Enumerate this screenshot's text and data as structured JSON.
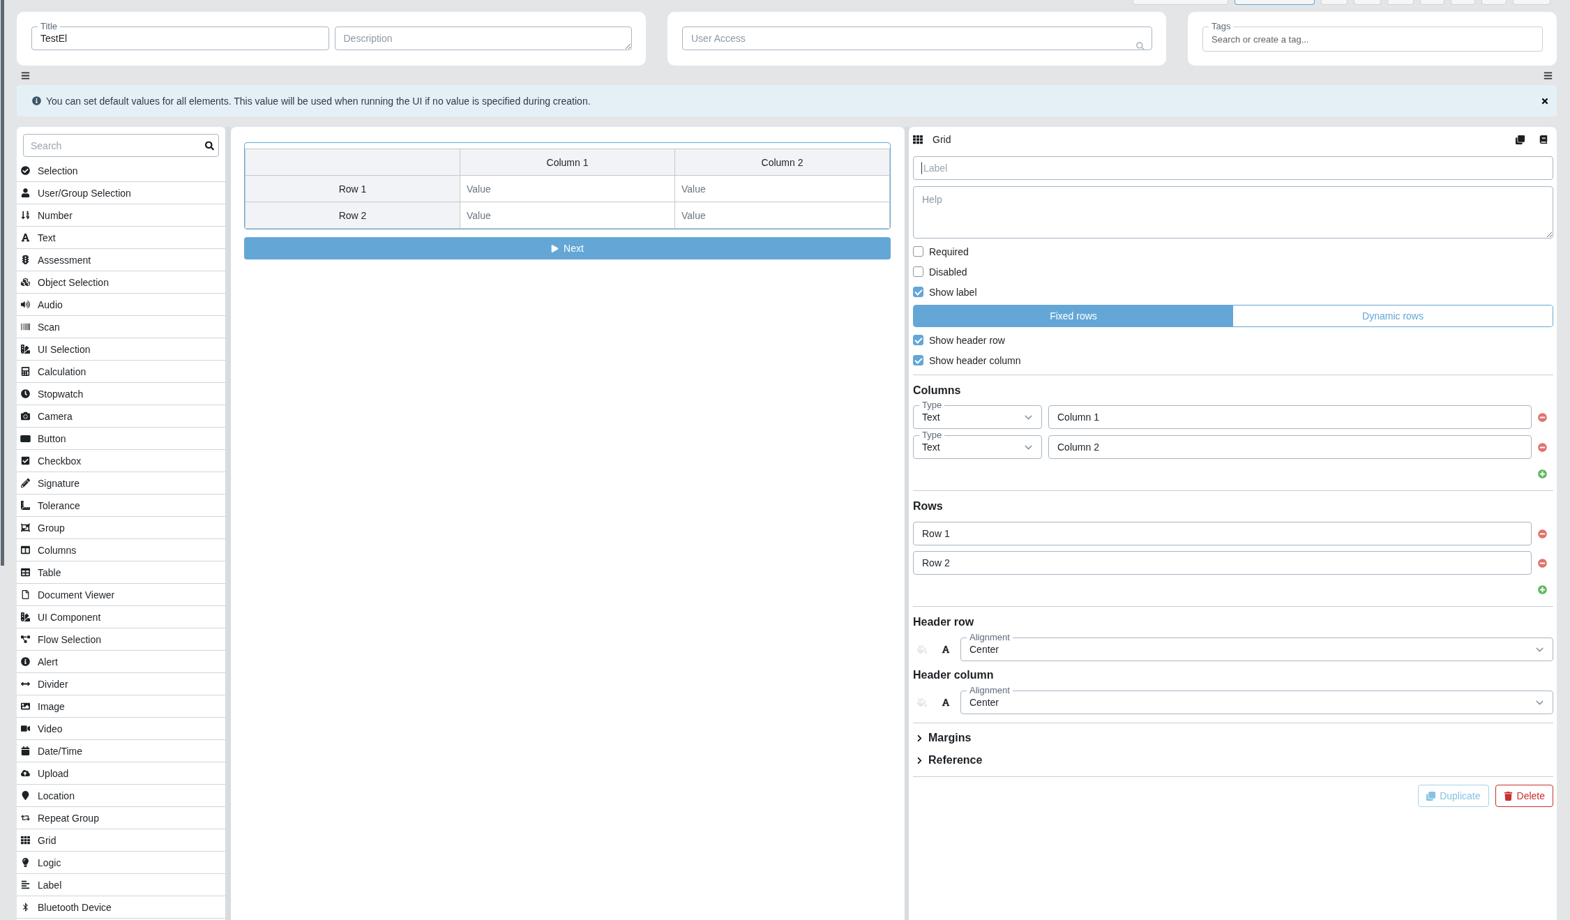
{
  "toolbar": {
    "buttons": [
      {
        "kind": "default"
      },
      {
        "kind": "primary"
      },
      {
        "kind": "default"
      },
      {
        "kind": "default"
      },
      {
        "kind": "default"
      },
      {
        "kind": "default"
      },
      {
        "kind": "default"
      },
      {
        "kind": "default"
      },
      {
        "kind": "default"
      }
    ]
  },
  "form_header": {
    "title_field": {
      "label": "Title",
      "value": "TestEl"
    },
    "description_field": {
      "placeholder": "Description"
    },
    "user_access_field": {
      "placeholder": "User Access"
    },
    "tags_field": {
      "label": "Tags",
      "placeholder": "Search or create a tag..."
    }
  },
  "info_alert": {
    "text": "You can set default values for all elements. This value will be used when running the UI if no value is specified during creation."
  },
  "palette": {
    "search": {
      "placeholder": "Search"
    },
    "items": [
      "Selection",
      "User/Group Selection",
      "Number",
      "Text",
      "Assessment",
      "Object Selection",
      "Audio",
      "Scan",
      "UI Selection",
      "Calculation",
      "Stopwatch",
      "Camera",
      "Button",
      "Checkbox",
      "Signature",
      "Tolerance",
      "Group",
      "Columns",
      "Table",
      "Document Viewer",
      "UI Component",
      "Flow Selection",
      "Alert",
      "Divider",
      "Image",
      "Video",
      "Date/Time",
      "Upload",
      "Location",
      "Repeat Group",
      "Grid",
      "Logic",
      "Label",
      "Bluetooth Device"
    ]
  },
  "canvas": {
    "grid": {
      "columns": [
        "Column 1",
        "Column 2"
      ],
      "rows": [
        {
          "header": "Row 1",
          "cells": [
            {
              "placeholder": "Value"
            },
            {
              "placeholder": "Value"
            }
          ]
        },
        {
          "header": "Row 2",
          "cells": [
            {
              "placeholder": "Value"
            },
            {
              "placeholder": "Value"
            }
          ]
        }
      ]
    },
    "next_button": {
      "label": "Next"
    }
  },
  "properties": {
    "title": "Grid",
    "label_field": {
      "placeholder": "Label",
      "focused": true
    },
    "help_field": {
      "placeholder": "Help"
    },
    "options": [
      {
        "label": "Required",
        "checked": false
      },
      {
        "label": "Disabled",
        "checked": false
      },
      {
        "label": "Show label",
        "checked": true
      }
    ],
    "row_mode_tabs": [
      {
        "label": "Fixed rows",
        "selected": true
      },
      {
        "label": "Dynamic rows",
        "selected": false
      }
    ],
    "header_options": [
      {
        "label": "Show header row",
        "checked": true
      },
      {
        "label": "Show header column",
        "checked": true
      }
    ],
    "columns": {
      "heading": "Columns",
      "items": [
        {
          "type": {
            "label": "Type",
            "value": "Text"
          },
          "name": "Column 1"
        },
        {
          "type": {
            "label": "Type",
            "value": "Text"
          },
          "name": "Column 2"
        }
      ]
    },
    "rows": {
      "heading": "Rows",
      "items": [
        "Row 1",
        "Row 2"
      ]
    },
    "header_row": {
      "heading": "Header row",
      "fill_button": {
        "disabled": true
      },
      "alignment": {
        "label": "Alignment",
        "value": "Center"
      }
    },
    "header_column": {
      "heading": "Header column",
      "fill_button": {
        "disabled": true
      },
      "alignment": {
        "label": "Alignment",
        "value": "Center"
      }
    },
    "sections": [
      {
        "label": "Margins",
        "expanded": false
      },
      {
        "label": "Reference",
        "expanded": false
      }
    ],
    "actions": [
      {
        "label": "Duplicate",
        "kind": "duplicate"
      },
      {
        "label": "Delete",
        "kind": "delete"
      }
    ]
  }
}
